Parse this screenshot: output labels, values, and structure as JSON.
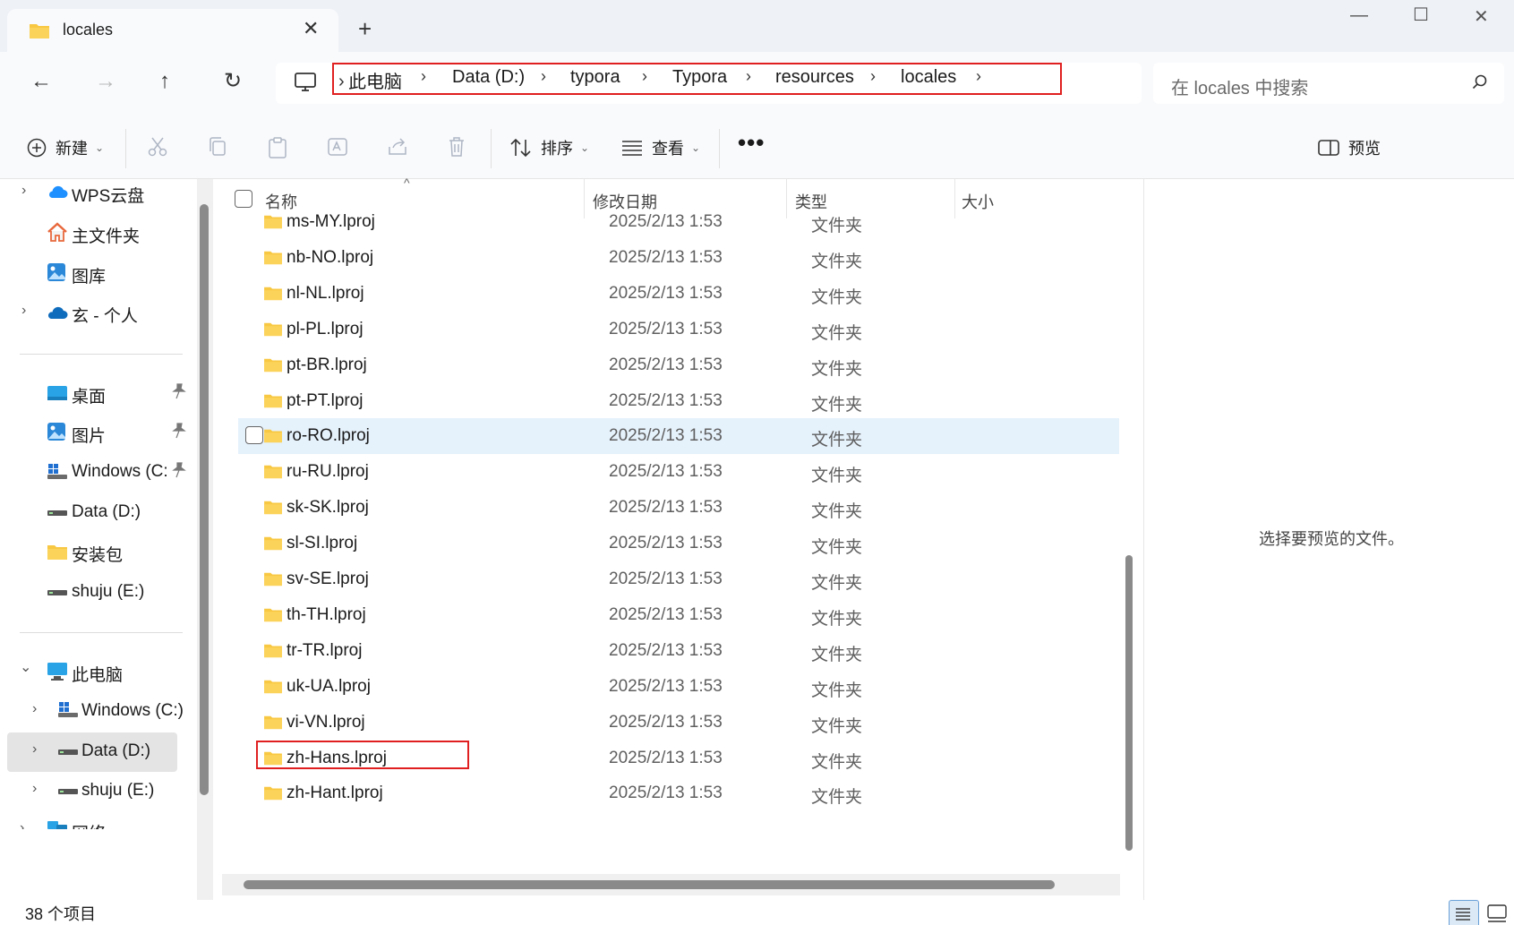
{
  "window": {
    "tab_title": "locales",
    "tab_close": "✕",
    "new_tab": "+",
    "minimize": "—",
    "maximize": "☐",
    "close": "✕"
  },
  "nav": {
    "back": "←",
    "forward": "→",
    "up": "↑",
    "refresh": "↻",
    "crumb_chevron": "›",
    "breadcrumbs": [
      "此电脑",
      "Data (D:)",
      "typora",
      "Typora",
      "resources",
      "locales"
    ],
    "search_placeholder": "在 locales 中搜索"
  },
  "toolbar": {
    "new_label": "新建",
    "sort_label": "排序",
    "view_label": "查看",
    "more": "•••",
    "preview_label": "预览",
    "chevron": "⌄"
  },
  "sidebar": {
    "expander_collapsed": "›",
    "expander_expanded": "⌄",
    "items": [
      {
        "label": "WPS云盘",
        "icon": "cloud-icon"
      },
      {
        "label": "主文件夹",
        "icon": "home-icon"
      },
      {
        "label": "图库",
        "icon": "gallery-icon"
      },
      {
        "label": "玄 - 个人",
        "icon": "onedrive-icon"
      },
      {
        "label": "桌面",
        "icon": "desktop-icon"
      },
      {
        "label": "图片",
        "icon": "pictures-icon"
      },
      {
        "label": "Windows (C:",
        "icon": "windows-drive-icon"
      },
      {
        "label": "Data (D:)",
        "icon": "drive-icon"
      },
      {
        "label": "安装包",
        "icon": "folder-icon"
      },
      {
        "label": "shuju (E:)",
        "icon": "drive-icon"
      },
      {
        "label": "此电脑",
        "icon": "this-pc-icon"
      },
      {
        "label": "Windows (C:)",
        "icon": "windows-drive-icon"
      },
      {
        "label": "Data (D:)",
        "icon": "drive-icon"
      },
      {
        "label": "shuju (E:)",
        "icon": "drive-icon"
      },
      {
        "label": "网络",
        "icon": "network-icon"
      }
    ]
  },
  "columns": {
    "name": "名称",
    "modified": "修改日期",
    "type": "类型",
    "size": "大小",
    "sort_caret": "^"
  },
  "files": [
    {
      "name": "ms-MY.lproj",
      "date": "2025/2/13 1:53",
      "type": "文件夹"
    },
    {
      "name": "nb-NO.lproj",
      "date": "2025/2/13 1:53",
      "type": "文件夹"
    },
    {
      "name": "nl-NL.lproj",
      "date": "2025/2/13 1:53",
      "type": "文件夹"
    },
    {
      "name": "pl-PL.lproj",
      "date": "2025/2/13 1:53",
      "type": "文件夹"
    },
    {
      "name": "pt-BR.lproj",
      "date": "2025/2/13 1:53",
      "type": "文件夹"
    },
    {
      "name": "pt-PT.lproj",
      "date": "2025/2/13 1:53",
      "type": "文件夹"
    },
    {
      "name": "ro-RO.lproj",
      "date": "2025/2/13 1:53",
      "type": "文件夹"
    },
    {
      "name": "ru-RU.lproj",
      "date": "2025/2/13 1:53",
      "type": "文件夹"
    },
    {
      "name": "sk-SK.lproj",
      "date": "2025/2/13 1:53",
      "type": "文件夹"
    },
    {
      "name": "sl-SI.lproj",
      "date": "2025/2/13 1:53",
      "type": "文件夹"
    },
    {
      "name": "sv-SE.lproj",
      "date": "2025/2/13 1:53",
      "type": "文件夹"
    },
    {
      "name": "th-TH.lproj",
      "date": "2025/2/13 1:53",
      "type": "文件夹"
    },
    {
      "name": "tr-TR.lproj",
      "date": "2025/2/13 1:53",
      "type": "文件夹"
    },
    {
      "name": "uk-UA.lproj",
      "date": "2025/2/13 1:53",
      "type": "文件夹"
    },
    {
      "name": "vi-VN.lproj",
      "date": "2025/2/13 1:53",
      "type": "文件夹"
    },
    {
      "name": "zh-Hans.lproj",
      "date": "2025/2/13 1:53",
      "type": "文件夹"
    },
    {
      "name": "zh-Hant.lproj",
      "date": "2025/2/13 1:53",
      "type": "文件夹"
    }
  ],
  "preview": {
    "empty_text": "选择要预览的文件。"
  },
  "status": {
    "item_count": "38 个项目"
  },
  "colors": {
    "highlight_red": "#e02020",
    "folder_yellow": "#f8c842",
    "row_hover": "#e5f1fb"
  }
}
